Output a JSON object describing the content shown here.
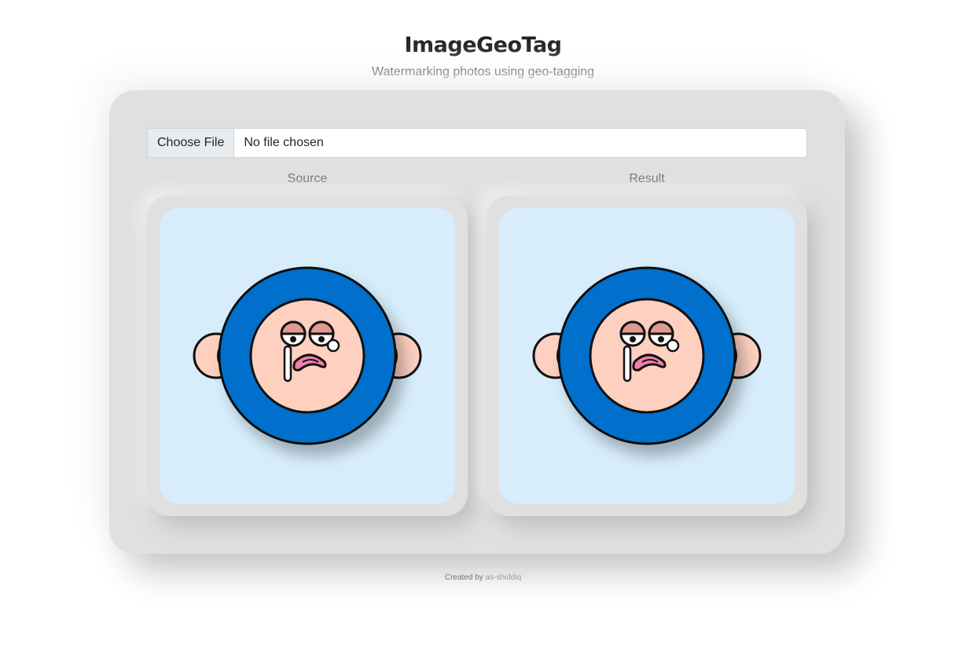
{
  "app": {
    "title": "ImageGeoTag",
    "subtitle": "Watermarking photos using geo-tagging"
  },
  "upload": {
    "button_label": "Choose File",
    "status": "No file chosen"
  },
  "panels": {
    "source_label": "Source",
    "result_label": "Result"
  },
  "footer": {
    "prefix": "Created by",
    "author": "as-shiddiq"
  },
  "colors": {
    "card_bg": "#e0e0e0",
    "image_bg": "#d7edfb",
    "head_blue": "#0070cc",
    "skin": "#fdd0c0",
    "tongue": "#f27fae"
  }
}
